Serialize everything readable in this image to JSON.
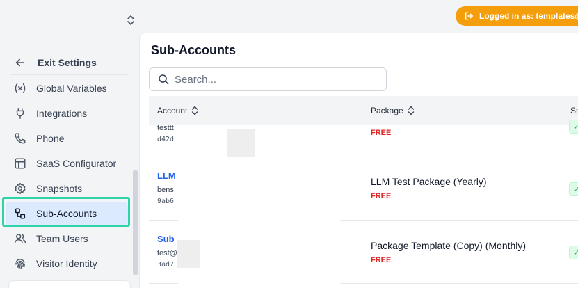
{
  "sidebar": {
    "exit_label": "Exit Settings",
    "items": [
      {
        "label": "Global Variables",
        "icon": "variable-icon"
      },
      {
        "label": "Integrations",
        "icon": "plug-icon"
      },
      {
        "label": "Phone",
        "icon": "phone-icon"
      },
      {
        "label": "SaaS Configurator",
        "icon": "layout-icon"
      },
      {
        "label": "Snapshots",
        "icon": "gear-icon"
      },
      {
        "label": "Sub-Accounts",
        "icon": "sub-accounts-icon",
        "active": true
      },
      {
        "label": "Team Users",
        "icon": "users-icon"
      },
      {
        "label": "Visitor Identity",
        "icon": "fingerprint-icon"
      }
    ]
  },
  "topbar": {
    "login_text": "Logged in as: templates@"
  },
  "main": {
    "title": "Sub-Accounts",
    "search_placeholder": "Search...",
    "columns": {
      "account": "Account",
      "package": "Package",
      "status": "St"
    },
    "rows": [
      {
        "name": "",
        "email": "testtt",
        "id": "d42d",
        "package": "",
        "tier": "FREE"
      },
      {
        "name": "LLM",
        "email": "bens",
        "id": "9ab6",
        "package": "LLM Test Package (Yearly)",
        "tier": "FREE"
      },
      {
        "name": "Sub",
        "email": "test@",
        "id": "3ad7",
        "package": "Package Template (Copy) (Monthly)",
        "tier": "FREE"
      }
    ]
  },
  "colors": {
    "accent": "#f59e0b",
    "active_bg": "#dbeafe",
    "link": "#2563eb",
    "free": "#dc2626",
    "highlight": "#2dd4a7"
  }
}
